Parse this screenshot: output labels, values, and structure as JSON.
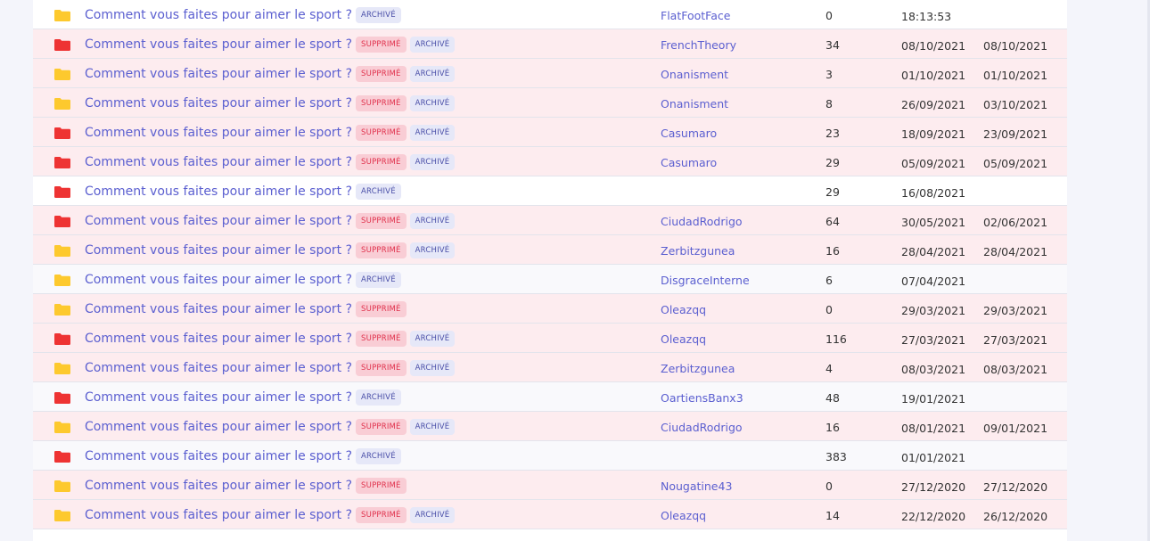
{
  "colors": {
    "folder_red": "#ee3333",
    "folder_yellow": "#fdc92e",
    "link": "#5b5fd0"
  },
  "labels": {
    "deleted": "SUPPRIMÉ",
    "archived": "ARCHIVÉ"
  },
  "rows": [
    {
      "title": "Comment vous faites pour aimer le sport ?",
      "icon": "folder-yellow-icon",
      "deleted": false,
      "archived": true,
      "author": "FlatFootFace",
      "count": "0",
      "date1": "18:13:53",
      "date2": ""
    },
    {
      "title": "Comment vous faites pour aimer le sport ?",
      "icon": "folder-red-icon",
      "deleted": true,
      "archived": true,
      "author": "FrenchTheory",
      "count": "34",
      "date1": "08/10/2021",
      "date2": "08/10/2021"
    },
    {
      "title": "Comment vous faites pour aimer le sport ?",
      "icon": "folder-yellow-icon",
      "deleted": true,
      "archived": true,
      "author": "Onanisment",
      "count": "3",
      "date1": "01/10/2021",
      "date2": "01/10/2021"
    },
    {
      "title": "Comment vous faites pour aimer le sport ?",
      "icon": "folder-yellow-icon",
      "deleted": true,
      "archived": true,
      "author": "Onanisment",
      "count": "8",
      "date1": "26/09/2021",
      "date2": "03/10/2021"
    },
    {
      "title": "Comment vous faites pour aimer le sport ?",
      "icon": "folder-red-icon",
      "deleted": true,
      "archived": true,
      "author": "Casumaro",
      "count": "23",
      "date1": "18/09/2021",
      "date2": "23/09/2021"
    },
    {
      "title": "Comment vous faites pour aimer le sport ?",
      "icon": "folder-red-icon",
      "deleted": true,
      "archived": true,
      "author": "Casumaro",
      "count": "29",
      "date1": "05/09/2021",
      "date2": "05/09/2021"
    },
    {
      "title": "Comment vous faites pour aimer le sport ?",
      "icon": "folder-red-icon",
      "deleted": false,
      "archived": true,
      "author": "",
      "count": "29",
      "date1": "16/08/2021",
      "date2": ""
    },
    {
      "title": "Comment vous faites pour aimer le sport ?",
      "icon": "folder-red-icon",
      "deleted": true,
      "archived": true,
      "author": "CiudadRodrigo",
      "count": "64",
      "date1": "30/05/2021",
      "date2": "02/06/2021"
    },
    {
      "title": "Comment vous faites pour aimer le sport ?",
      "icon": "folder-yellow-icon",
      "deleted": true,
      "archived": true,
      "author": "Zerbitzgunea",
      "count": "16",
      "date1": "28/04/2021",
      "date2": "28/04/2021"
    },
    {
      "title": "Comment vous faites pour aimer le sport ?",
      "icon": "folder-yellow-icon",
      "deleted": false,
      "archived": true,
      "author": "DisgraceInterne",
      "count": "6",
      "date1": "07/04/2021",
      "date2": ""
    },
    {
      "title": "Comment vous faites pour aimer le sport ?",
      "icon": "folder-yellow-icon",
      "deleted": true,
      "archived": false,
      "author": "Oleazqq",
      "count": "0",
      "date1": "29/03/2021",
      "date2": "29/03/2021"
    },
    {
      "title": "Comment vous faites pour aimer le sport ?",
      "icon": "folder-red-icon",
      "deleted": true,
      "archived": true,
      "author": "Oleazqq",
      "count": "116",
      "date1": "27/03/2021",
      "date2": "27/03/2021"
    },
    {
      "title": "Comment vous faites pour aimer le sport ?",
      "icon": "folder-yellow-icon",
      "deleted": true,
      "archived": true,
      "author": "Zerbitzgunea",
      "count": "4",
      "date1": "08/03/2021",
      "date2": "08/03/2021"
    },
    {
      "title": "Comment vous faites pour aimer le sport ?",
      "icon": "folder-red-icon",
      "deleted": false,
      "archived": true,
      "author": "OartiensBanx3",
      "count": "48",
      "date1": "19/01/2021",
      "date2": ""
    },
    {
      "title": "Comment vous faites pour aimer le sport ?",
      "icon": "folder-yellow-icon",
      "deleted": true,
      "archived": true,
      "author": "CiudadRodrigo",
      "count": "16",
      "date1": "08/01/2021",
      "date2": "09/01/2021"
    },
    {
      "title": "Comment vous faites pour aimer le sport ?",
      "icon": "folder-red-icon",
      "deleted": false,
      "archived": true,
      "author": "",
      "count": "383",
      "date1": "01/01/2021",
      "date2": ""
    },
    {
      "title": "Comment vous faites pour aimer le sport ?",
      "icon": "folder-yellow-icon",
      "deleted": true,
      "archived": false,
      "author": "Nougatine43",
      "count": "0",
      "date1": "27/12/2020",
      "date2": "27/12/2020"
    },
    {
      "title": "Comment vous faites pour aimer le sport ?",
      "icon": "folder-yellow-icon",
      "deleted": true,
      "archived": true,
      "author": "Oleazqq",
      "count": "14",
      "date1": "22/12/2020",
      "date2": "26/12/2020"
    }
  ]
}
